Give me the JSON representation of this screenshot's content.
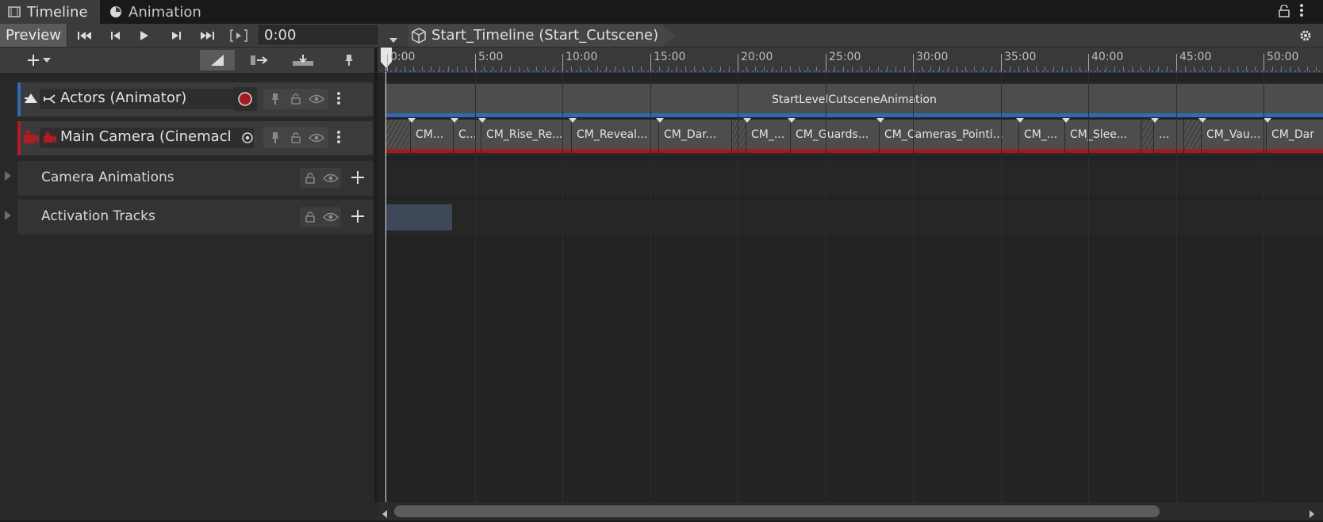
{
  "tabs": [
    {
      "label": "Timeline",
      "icon": "film-icon"
    },
    {
      "label": "Animation",
      "icon": "clock-icon"
    }
  ],
  "toolbar": {
    "preview_label": "Preview",
    "time_value": "0:00",
    "breadcrumb": "Start_Timeline (Start_Cutscene)"
  },
  "tracks": [
    {
      "name": "Actors (Animator)",
      "accent": "#2f6ab3",
      "kind": "animation"
    },
    {
      "name": "Main Camera (Cinemachine",
      "accent": "#b01c22",
      "kind": "cinemachine"
    }
  ],
  "groups": [
    {
      "name": "Camera Animations"
    },
    {
      "name": "Activation Tracks"
    }
  ],
  "ruler_labels": [
    "0:00",
    "5:00",
    "10:00",
    "15:00",
    "20:00",
    "25:00",
    "30:00",
    "35:00",
    "40:00",
    "45:00",
    "50:00"
  ],
  "actors_clip": {
    "label": "StartLevelCutsceneAnimation"
  },
  "camera_clips": [
    {
      "label": "CM..."
    },
    {
      "label": "C..."
    },
    {
      "label": "CM_Rise_Re..."
    },
    {
      "label": "CM_Reveal..."
    },
    {
      "label": "CM_Dar..."
    },
    {
      "label": "CM_..."
    },
    {
      "label": "CM_Guards..."
    },
    {
      "label": "CM_Cameras_Pointi..."
    },
    {
      "label": "CM_..."
    },
    {
      "label": "CM_Slee..."
    },
    {
      "label": "..."
    },
    {
      "label": "CM_Vau..."
    },
    {
      "label": "CM_Dar"
    }
  ],
  "colors": {
    "accent_blue": "#2f6ab3",
    "accent_red": "#b01c22"
  }
}
